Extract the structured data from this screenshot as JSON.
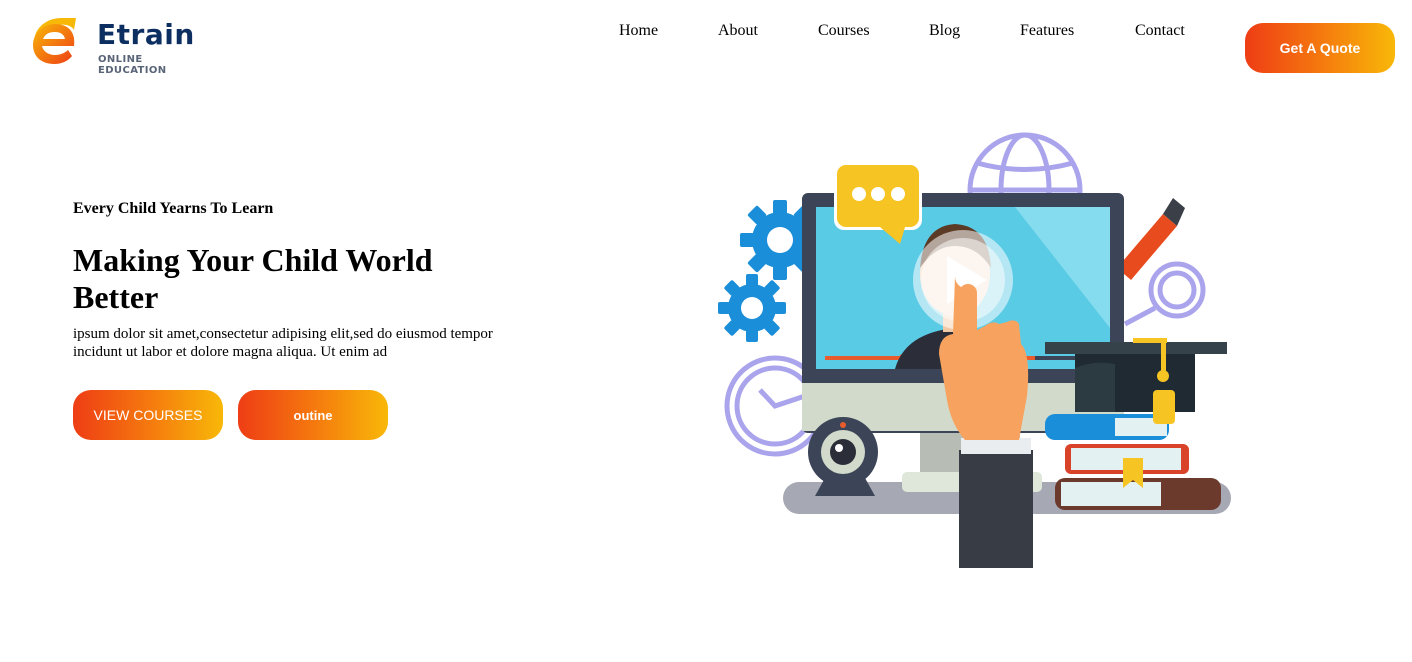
{
  "brand": {
    "name": "Etrain",
    "tagline": "ONLINE EDUCATION",
    "colors": {
      "navy": "#0c2e60",
      "orange": "#ee3d15",
      "yellow": "#f8b808"
    }
  },
  "nav": {
    "items": [
      {
        "label": "Home"
      },
      {
        "label": "About"
      },
      {
        "label": "Courses"
      },
      {
        "label": "Blog"
      },
      {
        "label": "Features"
      },
      {
        "label": "Contact"
      }
    ],
    "cta_label": "Get A Quote"
  },
  "hero": {
    "eyebrow": "Every Child Yearns To Learn",
    "title": "Making Your Child World Better",
    "description": "ipsum dolor sit amet,consectetur adipising elit,sed do eiusmod tempor incidunt ut labor et dolore magna aliqua. Ut enim ad",
    "buttons": {
      "primary_label": "VIEW COURSES",
      "secondary_label": "outine"
    },
    "illustration": {
      "icons": [
        "monitor-icon",
        "play-icon",
        "chat-bubble-icon",
        "globe-icon",
        "gear-icon",
        "clock-icon",
        "webcam-icon",
        "pencil-icon",
        "magnifier-icon",
        "graduation-cap-icon",
        "books-icon",
        "pointing-hand-icon"
      ]
    }
  }
}
